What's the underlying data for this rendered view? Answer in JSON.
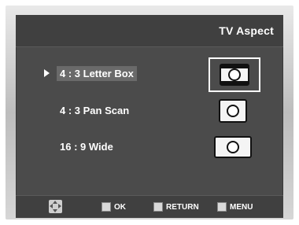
{
  "header": {
    "title": "TV Aspect"
  },
  "options": [
    {
      "label": "4 : 3  Letter Box",
      "selected": true,
      "icon": "letterbox-tv-icon"
    },
    {
      "label": "4 : 3 Pan Scan",
      "selected": false,
      "icon": "panscan-tv-icon"
    },
    {
      "label": "16 : 9 Wide",
      "selected": false,
      "icon": "widescreen-tv-icon"
    }
  ],
  "footer": {
    "nav_icon": "dpad-icon",
    "ok_label": "OK",
    "return_label": "RETURN",
    "menu_label": "MENU"
  },
  "colors": {
    "screen_bg": "#4b4b4b",
    "header_bg": "#404040",
    "highlight_bg": "#6a6a6a",
    "text": "#ffffff"
  }
}
